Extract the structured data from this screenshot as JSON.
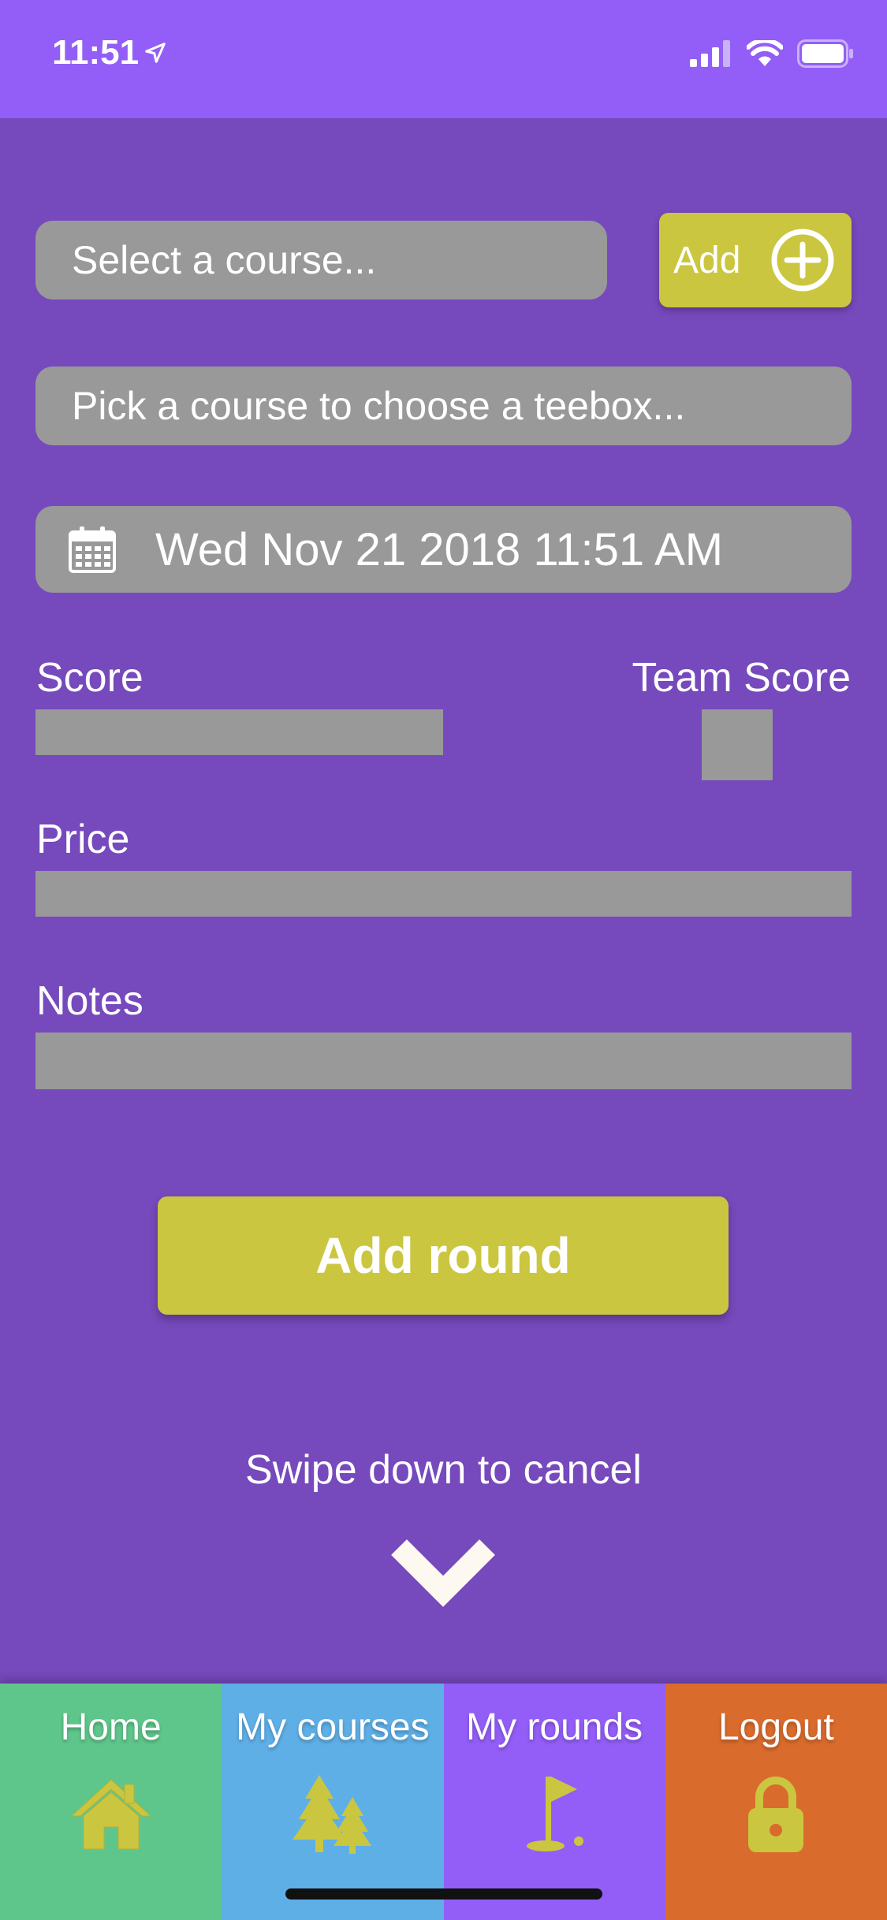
{
  "status_bar": {
    "time": "11:51"
  },
  "form": {
    "course_placeholder": "Select a course...",
    "add_course_label": "Add",
    "teebox_placeholder": "Pick a course to choose a teebox...",
    "date_value": "Wed Nov 21 2018 11:51 AM",
    "score_label": "Score",
    "team_score_label": "Team Score",
    "price_label": "Price",
    "notes_label": "Notes",
    "submit_label": "Add round"
  },
  "cancel_hint": "Swipe down to cancel",
  "tabs": [
    {
      "label": "Home",
      "icon": "home-icon"
    },
    {
      "label": "My courses",
      "icon": "trees-icon"
    },
    {
      "label": "My rounds",
      "icon": "golf-flag-icon"
    },
    {
      "label": "Logout",
      "icon": "lock-icon"
    }
  ],
  "colors": {
    "background": "#7649bc",
    "status_bar": "#935ef7",
    "accent": "#cbc63f",
    "field": "#999999",
    "tab_home": "#5fc68b",
    "tab_courses": "#5fafe7",
    "tab_rounds": "#935ef7",
    "tab_logout": "#d96b2d"
  }
}
